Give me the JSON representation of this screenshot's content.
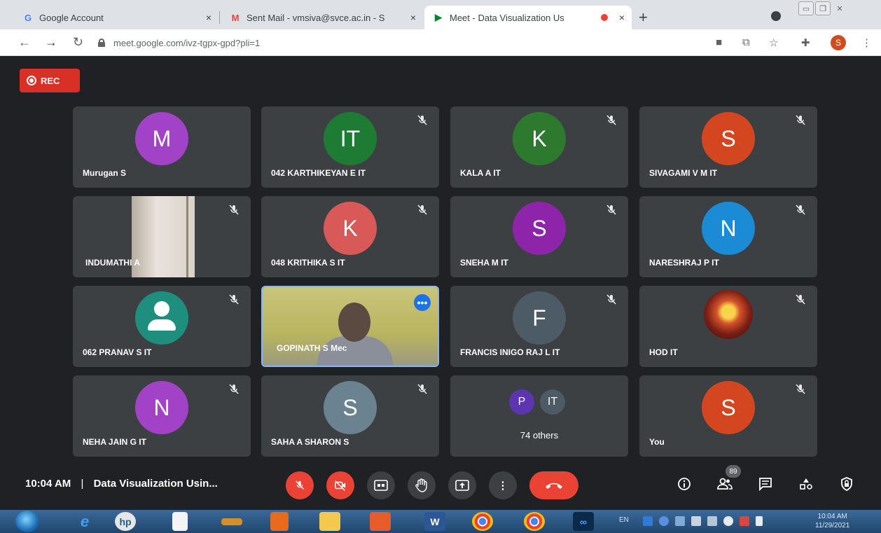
{
  "browser": {
    "tabs": [
      {
        "title": "Google Account",
        "favicon": "G",
        "favicon_color": "#4285f4",
        "close": "×"
      },
      {
        "title": "Sent Mail - vmsiva@svce.ac.in - S",
        "favicon": "M",
        "favicon_color": "#ea4335",
        "close": "×"
      },
      {
        "title": "Meet - Data Visualization Us",
        "favicon": "▶",
        "favicon_color": "#00832d",
        "close": "×"
      }
    ],
    "new_tab": "+",
    "url": "meet.google.com/ivz-tgpx-gpd?pli=1",
    "profile_initial": "S"
  },
  "meet": {
    "rec_label": "REC",
    "participants": [
      {
        "name": "Murugan S",
        "initial": "M",
        "color": "#a142c7",
        "muted": false
      },
      {
        "name": "042 KARTHIKEYAN E IT",
        "initial": "IT",
        "color": "#1e7b34",
        "muted": true
      },
      {
        "name": "KALA A IT",
        "initial": "K",
        "color": "#2d7a2f",
        "muted": true
      },
      {
        "name": "SIVAGAMI V M IT",
        "initial": "S",
        "color": "#d3461f",
        "muted": true
      },
      {
        "name": "INDUMATHI A",
        "initial": "",
        "color": "#3c4043",
        "muted": true
      },
      {
        "name": "048 KRITHIKA S IT",
        "initial": "K",
        "color": "#d95858",
        "muted": true
      },
      {
        "name": "SNEHA M IT",
        "initial": "S",
        "color": "#8e24aa",
        "muted": true
      },
      {
        "name": "NARESHRAJ P IT",
        "initial": "N",
        "color": "#1a8bd4",
        "muted": true
      },
      {
        "name": "062 PRANAV S IT",
        "initial": "",
        "color": "#1e8e7e",
        "muted": true
      },
      {
        "name": "GOPINATH S Mec",
        "initial": "",
        "color": "#b9b45f",
        "muted": false
      },
      {
        "name": "FRANCIS INIGO RAJ L IT",
        "initial": "F",
        "color": "#4d5b66",
        "muted": true
      },
      {
        "name": "HOD IT",
        "initial": "",
        "color": "#7a1f15",
        "muted": true
      },
      {
        "name": "NEHA JAIN G IT",
        "initial": "N",
        "color": "#a142c7",
        "muted": true
      },
      {
        "name": "SAHA A SHARON S",
        "initial": "S",
        "color": "#6b8290",
        "muted": true
      },
      {
        "name": "You",
        "initial": "S",
        "color": "#d3461f",
        "muted": true
      }
    ],
    "others": {
      "label": "74 others",
      "avatars": [
        {
          "initial": "P",
          "color": "#5e35b1"
        },
        {
          "initial": "IT",
          "color": "#4d5b66"
        }
      ]
    },
    "more_options": "•••"
  },
  "controls": {
    "time": "10:04 AM",
    "separator": "|",
    "meeting_title": "Data Visualization Usin...",
    "people_count": "89"
  },
  "taskbar": {
    "language": "EN",
    "clock_time": "10:04 AM",
    "clock_date": "11/29/2021"
  }
}
